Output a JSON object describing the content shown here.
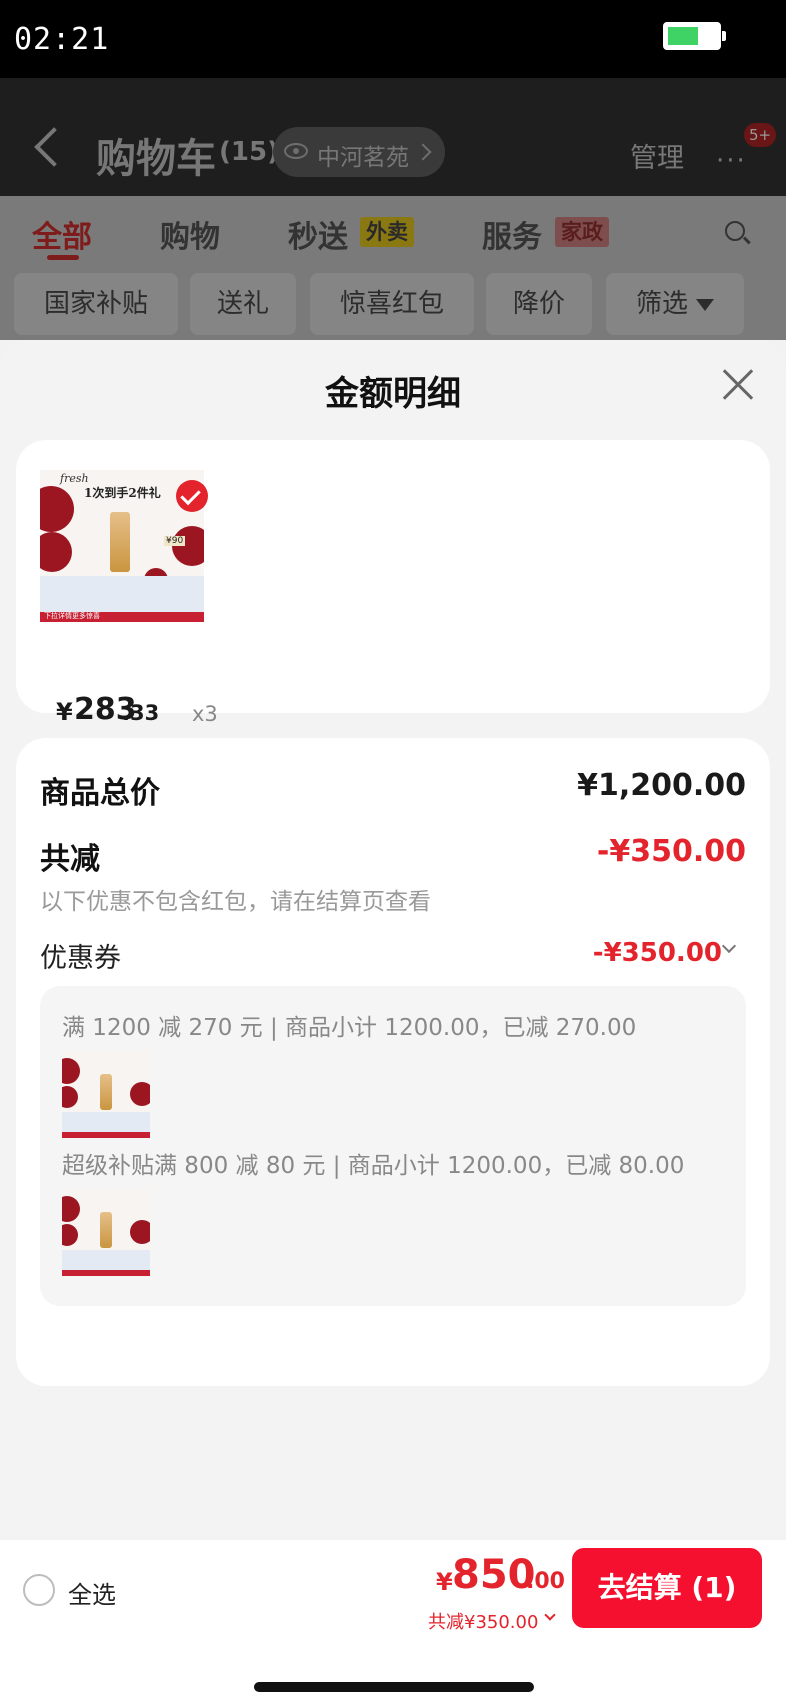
{
  "status_bar": {
    "time": "02:21"
  },
  "cart_page": {
    "title": "购物车",
    "count": "(15)",
    "address": "中河茗苑",
    "manage": "管理",
    "more": "···",
    "message_badge": "5+",
    "tabs": [
      {
        "label": "全部",
        "active": true
      },
      {
        "label": "购物",
        "active": false
      },
      {
        "label": "秒送",
        "active": false,
        "tag": "外卖"
      },
      {
        "label": "服务",
        "active": false,
        "tag": "家政"
      }
    ],
    "filters": [
      "国家补贴",
      "送礼",
      "惊喜红包",
      "降价",
      "筛选"
    ]
  },
  "sheet": {
    "title": "金额明细",
    "item": {
      "thumb": {
        "brand": "fresh",
        "headline": "1次到手2件礼",
        "badge": "¥90",
        "band": "下拉详情更多惊喜"
      },
      "currency": "¥",
      "price_int": "283",
      "price_dec": ".33",
      "quantity": "x3"
    },
    "summary": {
      "goods_total_label": "商品总价",
      "goods_total_value": "¥1,200.00",
      "discount_label": "共减",
      "discount_value": "-¥350.00",
      "note": "以下优惠不包含红包，请在结算页查看",
      "coupon_label": "优惠券",
      "coupon_value": "-¥350.00",
      "coupons": [
        {
          "text": "满 1200 减 270 元 | 商品小计 1200.00，已减 270.00"
        },
        {
          "text": "超级补贴满 800 减 80 元 | 商品小计 1200.00，已减 80.00"
        }
      ]
    }
  },
  "bottom_bar": {
    "select_all": "全选",
    "currency": "¥",
    "total_int": "850",
    "total_dec": ".00",
    "discount_summary": "共减¥350.00",
    "checkout_label": "去结算 (1)"
  },
  "colors": {
    "accent": "#e4242c",
    "checkout_button": "#f5102f",
    "selected_check": "#e4242c"
  }
}
